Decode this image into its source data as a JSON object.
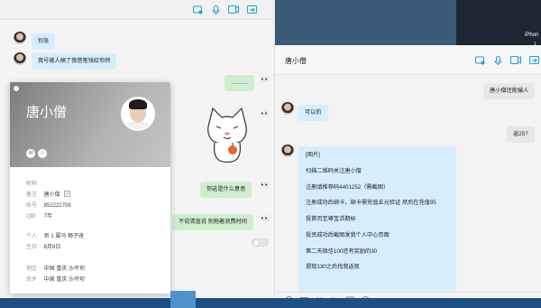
{
  "desktop": {
    "iphone_label": "iPhon",
    "iphone_sub": "1"
  },
  "back_window": {
    "title": "唐小僧",
    "messages": [
      {
        "side": "right",
        "text": "唐小僧还能骗人"
      },
      {
        "side": "left",
        "text": "可以的"
      },
      {
        "side": "right",
        "text": "返25?"
      },
      {
        "side": "left",
        "lines": [
          "[图片]",
          "扫描二维码关注唐小僧",
          "注册填推荐码4401252（需截图）",
          "注册成功后绑卡，绑卡需充值五元验证  然后在充值95",
          "投首页至尊宝活期标",
          "投资成功后截图发我个人中心页面",
          "第二天微信100还有奖励的30",
          "提现130之后找我返现"
        ]
      }
    ]
  },
  "front_window": {
    "messages": [
      {
        "side": "left",
        "text": "别急"
      },
      {
        "side": "left",
        "text": "我号被人搞了我借笔钱给你转"
      },
      {
        "side": "right",
        "text": "………"
      },
      {
        "side": "right",
        "text": "你这是什么意思"
      },
      {
        "side": "right",
        "text": "不说清直说 别拖着浪费时间"
      }
    ]
  },
  "profile_card": {
    "name": "唐小僧",
    "nickname_label": "昵称",
    "remark_label": "备注",
    "remark_value": "唐小僧",
    "account_label": "账号",
    "account_value": "852222708",
    "qage_label": "Q龄",
    "qage_value": "7年",
    "personal_label": "个人",
    "personal_value": "男  1 属马  狮子座",
    "birthday_label": "生日",
    "birthday_value": "8月8日",
    "location_label": "地区",
    "location_value": "中国  重庆  沙坪坝",
    "hometown_label": "故乡",
    "hometown_value": "中国  重庆  沙坪坝"
  },
  "colors": {
    "accent": "#1aa0d8",
    "left_bubble": "#d6eefc",
    "green_bubble": "#cfeecf",
    "right_bubble": "#e7e7e7"
  }
}
